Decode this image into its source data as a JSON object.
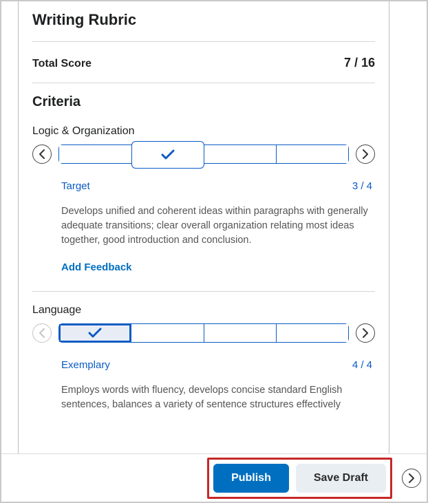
{
  "rubric": {
    "title": "Writing Rubric",
    "total_label": "Total Score",
    "total_value": "7 / 16",
    "criteria_heading": "Criteria",
    "add_feedback_label": "Add Feedback",
    "criteria": [
      {
        "name": "Logic & Organization",
        "segments": 4,
        "selected_index": 1,
        "selected_style": "pop",
        "level_name": "Target",
        "level_score": "3 / 4",
        "description": "Develops unified and coherent ideas within paragraphs with generally adequate transitions; clear overall organization relating most ideas together, good introduction and conclusion.",
        "prev_enabled": true,
        "next_enabled": true
      },
      {
        "name": "Language",
        "segments": 4,
        "selected_index": 0,
        "selected_style": "inset",
        "level_name": "Exemplary",
        "level_score": "4 / 4",
        "description": "Employs words with fluency, develops concise standard English sentences, balances a variety of sentence structures effectively",
        "prev_enabled": false,
        "next_enabled": true
      }
    ]
  },
  "footer": {
    "publish_label": "Publish",
    "save_draft_label": "Save Draft"
  }
}
